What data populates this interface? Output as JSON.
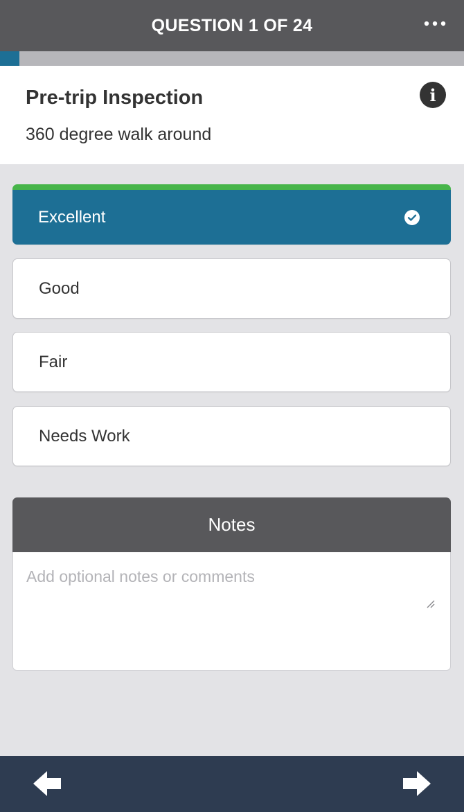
{
  "header": {
    "title": "QUESTION 1 OF 24",
    "menu_icon": "more-horizontal-icon"
  },
  "progress": {
    "current": 1,
    "total": 24,
    "fraction": 0.042
  },
  "question": {
    "title": "Pre-trip Inspection",
    "subtitle": "360 degree walk around",
    "info_icon": "info-icon"
  },
  "options": [
    {
      "label": "Excellent",
      "selected": true
    },
    {
      "label": "Good",
      "selected": false
    },
    {
      "label": "Fair",
      "selected": false
    },
    {
      "label": "Needs Work",
      "selected": false
    }
  ],
  "notes": {
    "title": "Notes",
    "placeholder": "Add optional notes or comments",
    "value": ""
  },
  "footer": {
    "prev_icon": "arrow-left-icon",
    "next_icon": "arrow-right-icon"
  },
  "colors": {
    "header_bg": "#58585b",
    "accent": "#1d6f95",
    "selected_top": "#47b54a",
    "footer_bg": "#2e3c51",
    "page_bg": "#e3e3e6"
  }
}
